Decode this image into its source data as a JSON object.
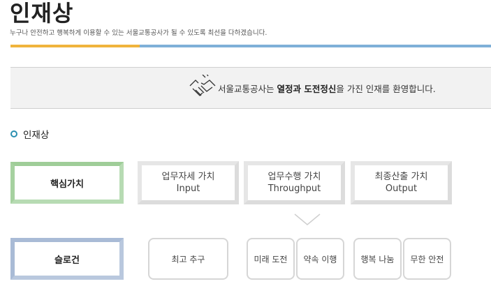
{
  "header": {
    "title": "인재상",
    "subtitle": "누구나 안전하고 행복하게 이용할 수 있는 서울교통공사가 될 수 있도록 최선을 다하겠습니다."
  },
  "banner": {
    "prefix": "서울교통공사는 ",
    "highlight": "열정과 도전정신",
    "suffix": "을 가진 인재를 환영합니다."
  },
  "section": {
    "heading": "인재상"
  },
  "values_row": {
    "main_label": "핵심가치",
    "cards": [
      {
        "title": "업무자세 가치",
        "sub": "Input"
      },
      {
        "title": "업무수행 가치",
        "sub": "Throughput"
      },
      {
        "title": "최종산출 가치",
        "sub": "Output"
      }
    ]
  },
  "slogan_row": {
    "main_label": "슬로건",
    "items": [
      "최고 추구",
      "미래 도전",
      "약속 이행",
      "행복 나눔",
      "무한 안전"
    ]
  },
  "colors": {
    "accent_orange": "#f0b43c",
    "accent_blue": "#7fb0d8",
    "green_frame": "#b7dbb3",
    "blue_frame": "#b9c8de"
  }
}
